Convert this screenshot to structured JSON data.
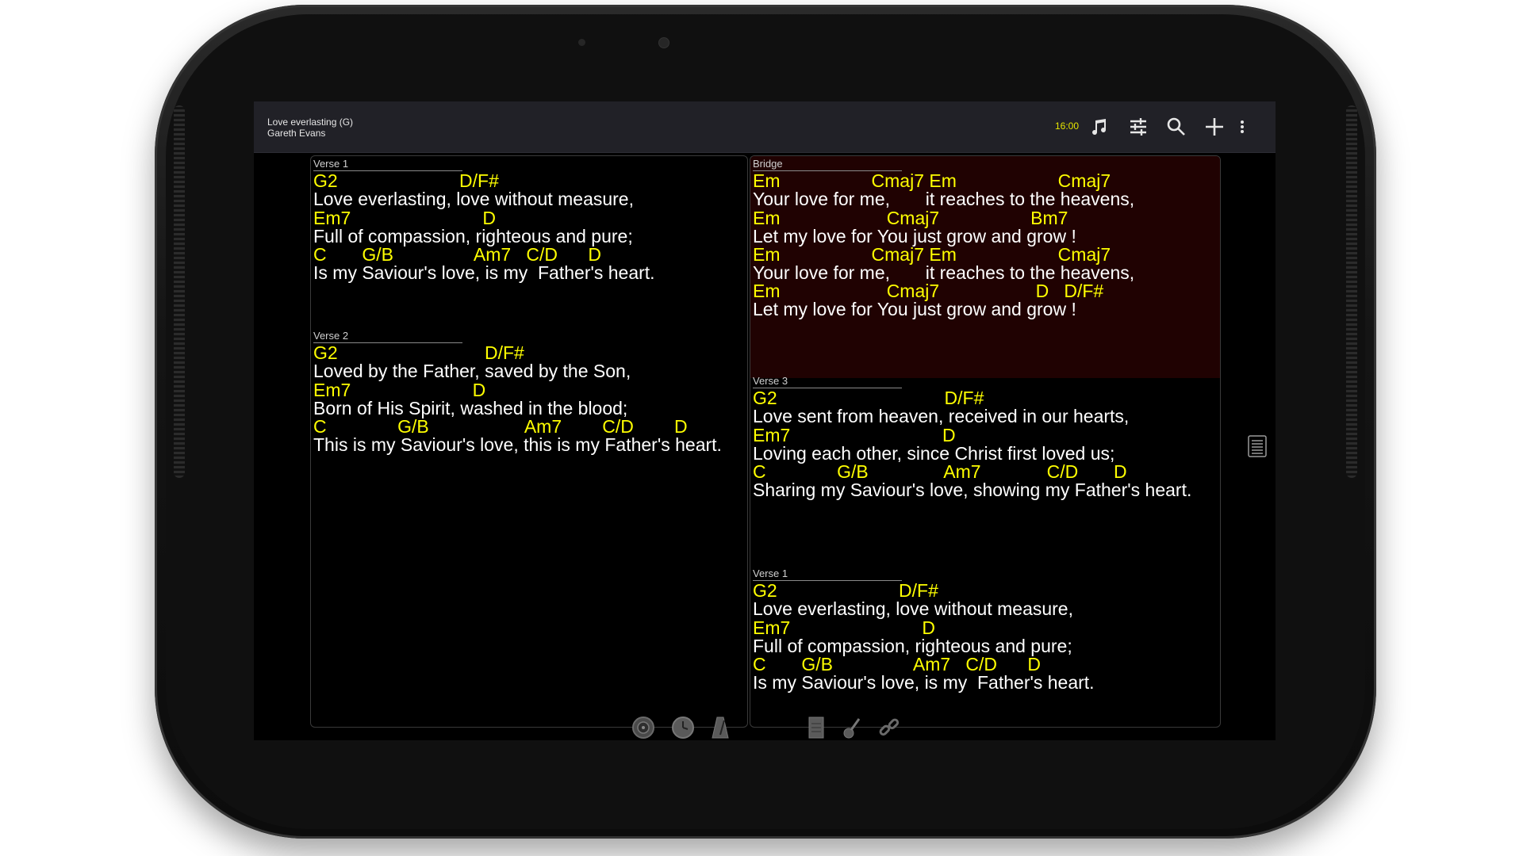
{
  "header": {
    "title": "Love everlasting (G)",
    "artist": "Gareth Evans",
    "time": "16:00",
    "icons": [
      "music-note-icon",
      "sliders-icon",
      "search-icon",
      "add-icon",
      "overflow-menu-icon"
    ]
  },
  "accent_colors": {
    "chord": "#ffff00",
    "lyric": "#ffffff",
    "bridge_bg": "#200202",
    "clock": "#e6e600"
  },
  "left_panel": {
    "verse1": {
      "label": "Verse 1",
      "l1": "G2                        D/F#",
      "l2": "Love everlasting, love without measure,",
      "l3": "Em7                          D",
      "l4": "Full of compassion, righteous and pure;",
      "l5": "C       G/B                Am7   C/D      D",
      "l6": "Is my Saviour's love, is my  Father's heart."
    },
    "verse2": {
      "label": "Verse 2",
      "l1": "G2                             D/F#",
      "l2": "Loved by the Father, saved by the Son,",
      "l3": "Em7                        D",
      "l4": "Born of His Spirit, washed in the blood;",
      "l5": "C              G/B                   Am7        C/D        D",
      "l6": "This is my Saviour's love, this is my Father's heart."
    }
  },
  "right_panel": {
    "bridge": {
      "label": "Bridge",
      "l1": "Em                  Cmaj7 Em                    Cmaj7",
      "l2": "Your love for me,       it reaches to the heavens,",
      "l3": "Em                     Cmaj7                  Bm7",
      "l4": "Let my love for You just grow and grow !",
      "l5": "Em                  Cmaj7 Em                    Cmaj7",
      "l6": "Your love for me,       it reaches to the heavens,",
      "l7": "Em                     Cmaj7                   D   D/F#",
      "l8": "Let my love for You just grow and grow !"
    },
    "verse3": {
      "label": "Verse 3",
      "l1": "G2                                 D/F#",
      "l2": "Love sent from heaven, received in our hearts,",
      "l3": "Em7                              D",
      "l4": "Loving each other, since Christ first loved us;",
      "l5": "C              G/B               Am7             C/D       D",
      "l6": "Sharing my Saviour's love, showing my Father's heart."
    },
    "verse1_repeat": {
      "label": "Verse 1",
      "l1": "G2                        D/F#",
      "l2": "Love everlasting, love without measure,",
      "l3": "Em7                          D",
      "l4": "Full of compassion, righteous and pure;",
      "l5": "C       G/B                Am7   C/D      D",
      "l6": "Is my Saviour's love, is my  Father's heart."
    }
  },
  "bottom_tools": [
    "speaker-icon",
    "clock-icon",
    "metronome-icon",
    "notepad-icon",
    "guitar-icon",
    "link-icon"
  ],
  "side_icon": "list-view-icon"
}
